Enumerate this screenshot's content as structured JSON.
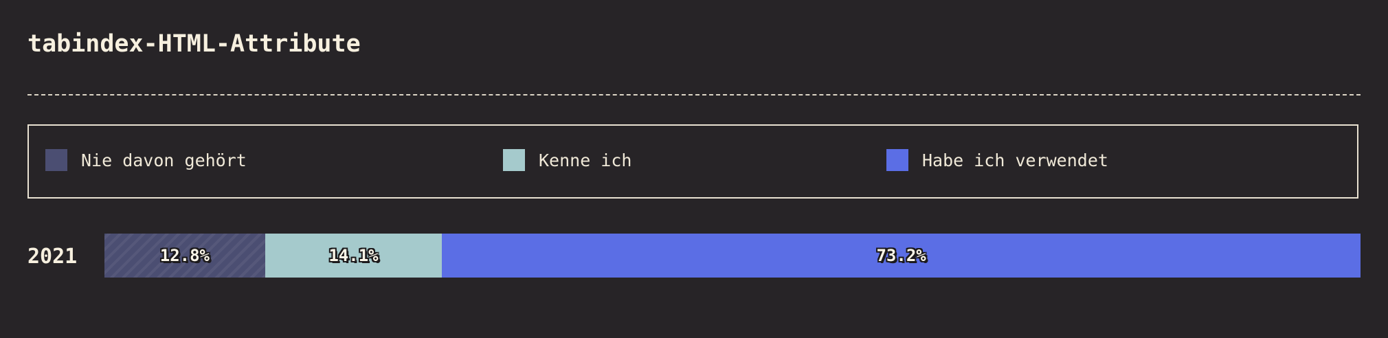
{
  "title": "tabindex-HTML-Attribute",
  "legend": [
    {
      "label": "Nie davon gehört",
      "color": "#4b4e72"
    },
    {
      "label": "Kenne ich",
      "color": "#a5cacc"
    },
    {
      "label": "Habe ich verwendet",
      "color": "#5b6ee5"
    }
  ],
  "chart_data": {
    "type": "bar",
    "orientation": "horizontal",
    "stacked": true,
    "normalized_percent": true,
    "categories": [
      "2021"
    ],
    "series": [
      {
        "name": "Nie davon gehört",
        "values": [
          12.8
        ],
        "label": "12.8%",
        "color": "#4b4e72"
      },
      {
        "name": "Kenne ich",
        "values": [
          14.1
        ],
        "label": "14.1%",
        "color": "#a5cacc"
      },
      {
        "name": "Habe ich verwendet",
        "values": [
          73.2
        ],
        "label": "73.2%",
        "color": "#5b6ee5"
      }
    ],
    "xlim": [
      0,
      100
    ],
    "legend_position": "top",
    "grid": false
  }
}
